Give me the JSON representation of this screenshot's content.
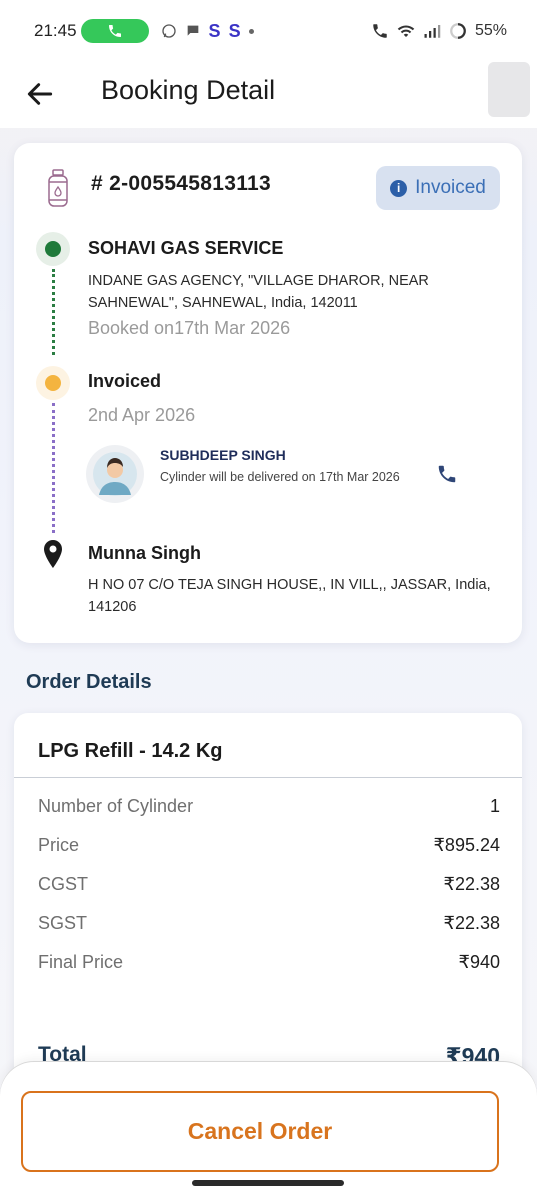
{
  "status_bar": {
    "time": "21:45",
    "battery": "55%",
    "app_letters": [
      "S",
      "S"
    ]
  },
  "header": {
    "title": "Booking Detail"
  },
  "booking": {
    "order_number": "# 2-005545813113",
    "status_badge": "Invoiced",
    "status_badge_color": "#3b6fb6",
    "agency": {
      "name": "SOHAVI GAS SERVICE",
      "address": "INDANE GAS AGENCY, \"VILLAGE DHAROR, NEAR SAHNEWAL\", SAHNEWAL, India, 142011",
      "booked": "Booked on17th Mar 2026"
    },
    "invoice": {
      "label": "Invoiced",
      "date": "2nd Apr 2026"
    },
    "delivery": {
      "name": "SUBHDEEP SINGH",
      "message": "Cylinder will be delivered on 17th Mar 2026"
    },
    "customer": {
      "name": "Munna Singh",
      "address": "H NO 07 C/O TEJA SINGH HOUSE,, IN VILL,, JASSAR, India, 141206"
    }
  },
  "order_details": {
    "heading": "Order Details",
    "product": "LPG Refill - 14.2 Kg",
    "rows": [
      {
        "label": "Number of Cylinder",
        "value": "1"
      },
      {
        "label": "Price",
        "value": "₹895.24"
      },
      {
        "label": "CGST",
        "value": "₹22.38"
      },
      {
        "label": "SGST",
        "value": "₹22.38"
      },
      {
        "label": "Final Price",
        "value": "₹940"
      }
    ],
    "total_label": "Total",
    "total_value": "₹940"
  },
  "actions": {
    "cancel_label": "Cancel Order",
    "accent_color": "#d9731c"
  }
}
